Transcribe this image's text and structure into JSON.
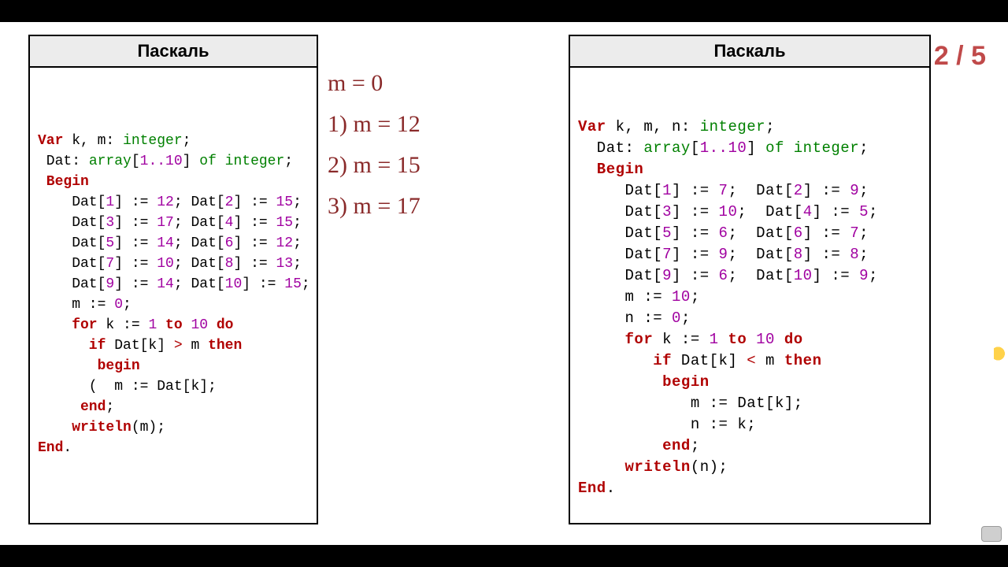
{
  "page_counter": "2 / 5",
  "box_title": "Паскаль",
  "annotations": {
    "a0": "m = 0",
    "a1": "1) m = 12",
    "a2": "2) m = 15",
    "a3": "3) m = 17"
  },
  "code_left": {
    "l01a": "Var",
    "l01b": " k, m: ",
    "l01c": "integer",
    "l01d": ";",
    "l02a": " Dat: ",
    "l02b": "array",
    "l02c": "[",
    "l02d": "1..10",
    "l02e": "] ",
    "l02f": "of integer",
    "l02g": ";",
    "l03a": " Begin",
    "l04a": "    Dat[",
    "l04b": "1",
    "l04c": "] := ",
    "l04d": "12",
    "l04e": "; Dat[",
    "l04f": "2",
    "l04g": "] := ",
    "l04h": "15",
    "l04i": ";",
    "l05a": "    Dat[",
    "l05b": "3",
    "l05c": "] := ",
    "l05d": "17",
    "l05e": "; Dat[",
    "l05f": "4",
    "l05g": "] := ",
    "l05h": "15",
    "l05i": ";",
    "l06a": "    Dat[",
    "l06b": "5",
    "l06c": "] := ",
    "l06d": "14",
    "l06e": "; Dat[",
    "l06f": "6",
    "l06g": "] := ",
    "l06h": "12",
    "l06i": ";",
    "l07a": "    Dat[",
    "l07b": "7",
    "l07c": "] := ",
    "l07d": "10",
    "l07e": "; Dat[",
    "l07f": "8",
    "l07g": "] := ",
    "l07h": "13",
    "l07i": ";",
    "l08a": "    Dat[",
    "l08b": "9",
    "l08c": "] := ",
    "l08d": "14",
    "l08e": "; Dat[",
    "l08f": "10",
    "l08g": "] := ",
    "l08h": "15",
    "l08i": ";",
    "l09a": "    m := ",
    "l09b": "0",
    "l09c": ";",
    "l10a": "    for",
    "l10b": " k := ",
    "l10c": "1",
    "l10d": " to ",
    "l10e": "10",
    "l10f": " do",
    "l11a": "      if",
    "l11b": " Dat[k] ",
    "l11c": ">",
    "l11d": " m ",
    "l11e": "then",
    "l12a": "       begin",
    "l13a": "      ( ",
    "l13b": " m := Dat[k];",
    "l14a": "     end",
    "l14b": ";",
    "l15a": "    writeln",
    "l15b": "(m);",
    "l16a": "End",
    "l16b": "."
  },
  "code_right": {
    "r01a": "Var",
    "r01b": " k, m, n: ",
    "r01c": "integer",
    "r01d": ";",
    "r02a": "  Dat: ",
    "r02b": "array",
    "r02c": "[",
    "r02d": "1..10",
    "r02e": "] ",
    "r02f": "of integer",
    "r02g": ";",
    "r03a": "  Begin",
    "r04a": "     Dat[",
    "r04b": "1",
    "r04c": "] := ",
    "r04d": "7",
    "r04e": ";  Dat[",
    "r04f": "2",
    "r04g": "] := ",
    "r04h": "9",
    "r04i": ";",
    "r05a": "     Dat[",
    "r05b": "3",
    "r05c": "] := ",
    "r05d": "10",
    "r05e": ";  Dat[",
    "r05f": "4",
    "r05g": "] := ",
    "r05h": "5",
    "r05i": ";",
    "r06a": "     Dat[",
    "r06b": "5",
    "r06c": "] := ",
    "r06d": "6",
    "r06e": ";  Dat[",
    "r06f": "6",
    "r06g": "] := ",
    "r06h": "7",
    "r06i": ";",
    "r07a": "     Dat[",
    "r07b": "7",
    "r07c": "] := ",
    "r07d": "9",
    "r07e": ";  Dat[",
    "r07f": "8",
    "r07g": "] := ",
    "r07h": "8",
    "r07i": ";",
    "r08a": "     Dat[",
    "r08b": "9",
    "r08c": "] := ",
    "r08d": "6",
    "r08e": ";  Dat[",
    "r08f": "10",
    "r08g": "] := ",
    "r08h": "9",
    "r08i": ";",
    "r09a": "     m := ",
    "r09b": "10",
    "r09c": ";",
    "r10a": "     n := ",
    "r10b": "0",
    "r10c": ";",
    "r11a": "     for",
    "r11b": " k := ",
    "r11c": "1",
    "r11d": " to ",
    "r11e": "10",
    "r11f": " do",
    "r12a": "        if",
    "r12b": " Dat[k] ",
    "r12c": "<",
    "r12d": " m ",
    "r12e": "then",
    "r13a": "         begin",
    "r14a": "            m := Dat[k];",
    "r15a": "            n := k;",
    "r16a": "         end",
    "r16b": ";",
    "r17a": "     writeln",
    "r17b": "(n);",
    "r18a": "End",
    "r18b": "."
  }
}
